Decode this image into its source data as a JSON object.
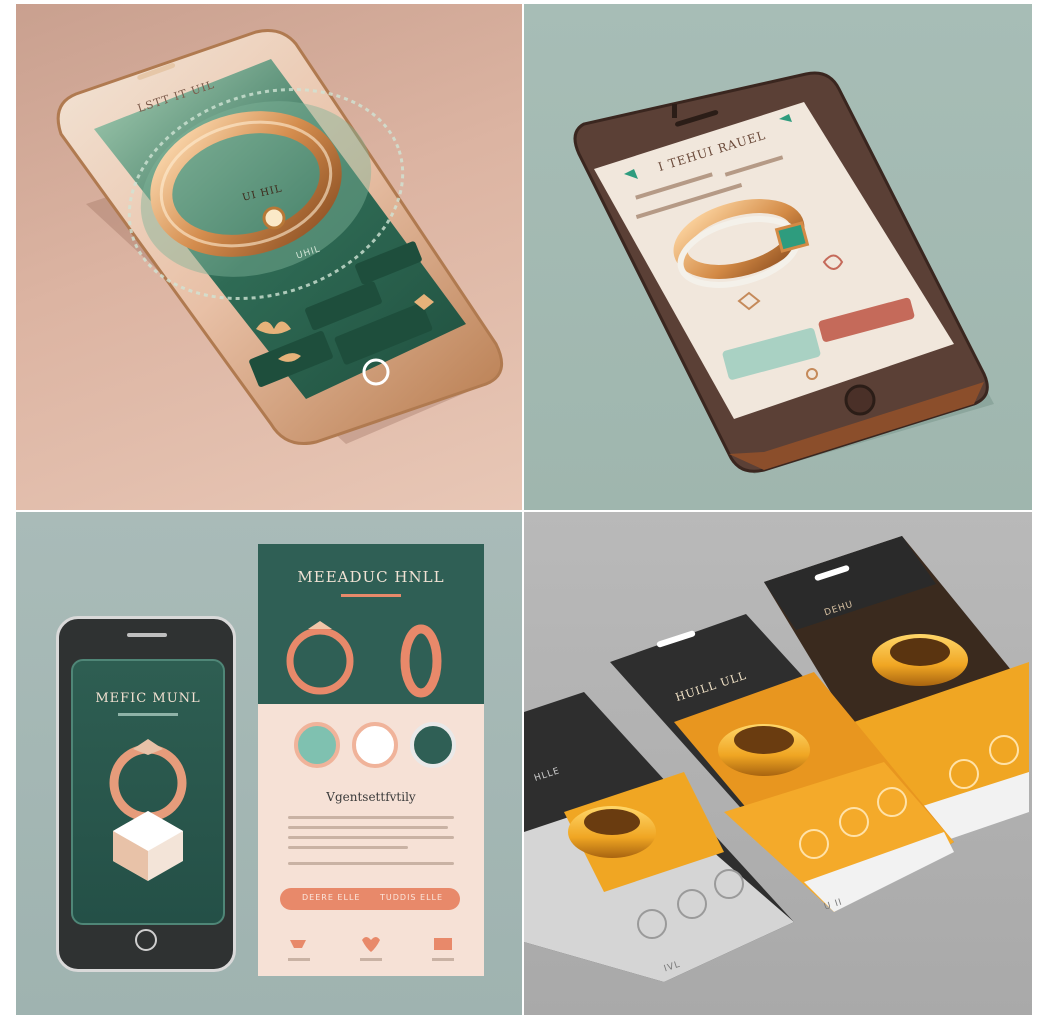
{
  "panels": [
    {
      "title": "LSTT IT UIL",
      "subtitle": "UI HIL",
      "caption": "UHIL",
      "colors": {
        "background": "#dcb4a2",
        "screen": "#2f6b55",
        "frame": "#c88a5f"
      },
      "icons": [
        "lotus-icon",
        "leaf-icon",
        "diamond-icon"
      ]
    },
    {
      "title": "I TEHUI RAUEL",
      "colors": {
        "background": "#a7bdb6",
        "screen": "#f1e7dc",
        "frame": "#5b4036"
      },
      "icons": [
        "heart-icon",
        "diamond-icon",
        "ring-icon"
      ]
    },
    {
      "phone_title": "MEFIC MUNL",
      "card_title": "MEEADUC HNLL",
      "card_heading": "Vgentsettfvtily",
      "buttons": [
        "DEERE ELLE",
        "TUDDIS ELLE"
      ],
      "footer_items": [
        "ring-icon",
        "heart-icon",
        "gift-icon"
      ],
      "colors": {
        "background": "#a9bbb8",
        "screen": "#2e5e52",
        "accent": "#e8896a",
        "card_bottom": "#f5ddd0"
      }
    },
    {
      "cards": [
        {
          "title": "HLLE",
          "footer": "IVL"
        },
        {
          "title": "HUILL ULL",
          "footer": "U II"
        },
        {
          "title": "DEHU",
          "footer": ""
        }
      ],
      "colors": {
        "background": "#b4b4b4",
        "top": "#3a3a3a",
        "accent": "#f0a623",
        "card": "#f2f2f2"
      }
    }
  ]
}
